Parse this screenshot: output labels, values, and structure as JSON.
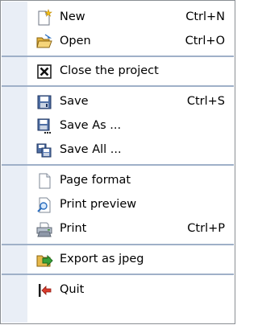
{
  "menu": {
    "items": [
      {
        "label": "New",
        "shortcut": "Ctrl+N",
        "icon": "new-document-icon"
      },
      {
        "label": "Open",
        "shortcut": "Ctrl+O",
        "icon": "open-folder-icon"
      },
      {
        "label": "Close the project",
        "icon": "close-project-icon"
      },
      {
        "label": "Save",
        "shortcut": "Ctrl+S",
        "icon": "save-icon"
      },
      {
        "label": "Save As ...",
        "icon": "save-as-icon"
      },
      {
        "label": "Save All ...",
        "icon": "save-all-icon"
      },
      {
        "label": "Page format",
        "icon": "page-format-icon"
      },
      {
        "label": "Print preview",
        "icon": "print-preview-icon"
      },
      {
        "label": "Print",
        "shortcut": "Ctrl+P",
        "icon": "printer-icon"
      },
      {
        "label": "Export as jpeg",
        "icon": "export-jpeg-icon"
      },
      {
        "label": "Quit",
        "icon": "quit-icon"
      }
    ]
  },
  "colors": {
    "gutter": "#e9eef6",
    "separator": "#9fb0c8",
    "border": "#8a8e93"
  }
}
